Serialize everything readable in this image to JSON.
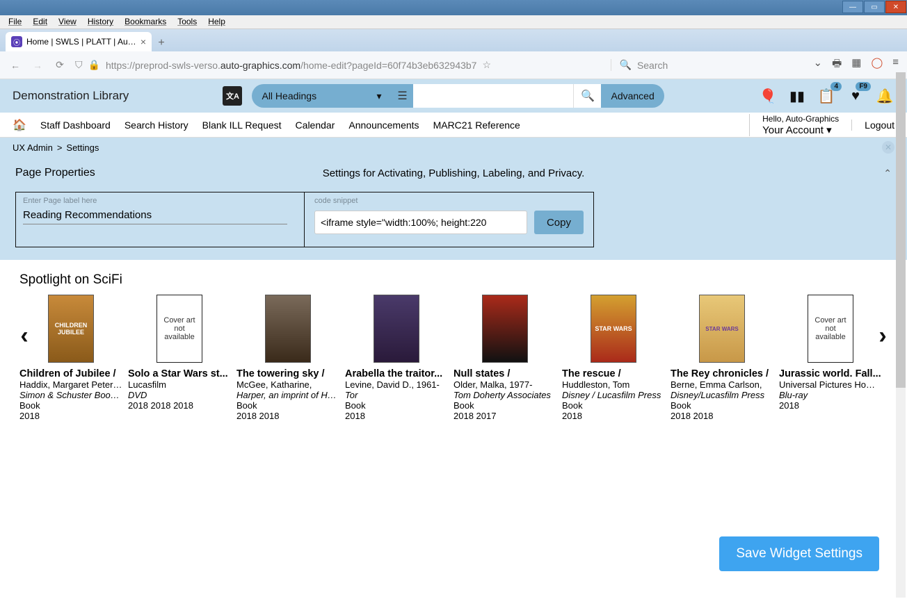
{
  "browser": {
    "menu": [
      "File",
      "Edit",
      "View",
      "History",
      "Bookmarks",
      "Tools",
      "Help"
    ],
    "tab_title": "Home | SWLS | PLATT | Auto-Gr",
    "url_prefix": "https://preprod-swls-verso.",
    "url_dark": "auto-graphics.com",
    "url_suffix": "/home-edit?pageId=60f74b3eb632943b7",
    "search_placeholder": "Search"
  },
  "app": {
    "library_name": "Demonstration Library",
    "headings_label": "All Headings",
    "advanced_label": "Advanced",
    "badges": {
      "list": "4",
      "heart": "F9"
    }
  },
  "nav": {
    "items": [
      "Staff Dashboard",
      "Search History",
      "Blank ILL Request",
      "Calendar",
      "Announcements",
      "MARC21 Reference"
    ],
    "greeting": "Hello, Auto-Graphics",
    "account": "Your Account",
    "logout": "Logout"
  },
  "breadcrumb": {
    "a": "UX Admin",
    "sep": ">",
    "b": "Settings"
  },
  "props": {
    "title": "Page Properties",
    "desc": "Settings for Activating, Publishing, Labeling, and Privacy.",
    "label_placeholder": "Enter Page label here",
    "label_value": "Reading Recommendations",
    "snippet_label": "code snippet",
    "snippet_value": "<iframe style=\"width:100%; height:220",
    "copy": "Copy"
  },
  "carousel": {
    "title": "Spotlight on SciFi",
    "items": [
      {
        "title": "Children of Jubilee /",
        "author": "Haddix, Margaret Peterson,",
        "pub": "Simon & Schuster Books fo...",
        "format": "Book",
        "year": "2018",
        "cover": "cov1",
        "cover_text": "CHILDREN JUBILEE"
      },
      {
        "title": "Solo a Star Wars st...",
        "author": "Lucasfilm",
        "pub": "DVD",
        "format": "2018 2018 2018",
        "year": "",
        "cover": "na",
        "cover_text": "Cover art not available"
      },
      {
        "title": "The towering sky /",
        "author": "McGee, Katharine,",
        "pub": "Harper, an imprint of Har...",
        "format": "Book",
        "year": "2018 2018",
        "cover": "cov3",
        "cover_text": ""
      },
      {
        "title": "Arabella the traitor...",
        "author": "Levine, David D., 1961-",
        "pub": "Tor",
        "format": "Book",
        "year": "2018",
        "cover": "cov4",
        "cover_text": ""
      },
      {
        "title": "Null states /",
        "author": "Older, Malka, 1977-",
        "pub": "Tom Doherty Associates",
        "format": "Book",
        "year": "2018 2017",
        "cover": "cov5",
        "cover_text": ""
      },
      {
        "title": "The rescue /",
        "author": "Huddleston, Tom",
        "pub": "Disney / Lucasfilm Press",
        "format": "Book",
        "year": "2018",
        "cover": "cov6",
        "cover_text": "STAR WARS"
      },
      {
        "title": "The Rey chronicles /",
        "author": "Berne, Emma Carlson,",
        "pub": "Disney/Lucasfilm Press",
        "format": "Book",
        "year": "2018 2018",
        "cover": "cov7",
        "cover_text": "STAR WARS"
      },
      {
        "title": "Jurassic world. Fall...",
        "author": "Universal Pictures Home E...",
        "pub": "Blu-ray",
        "format": "2018",
        "year": "",
        "cover": "na",
        "cover_text": "Cover art not available"
      }
    ]
  },
  "save_label": "Save Widget Settings"
}
